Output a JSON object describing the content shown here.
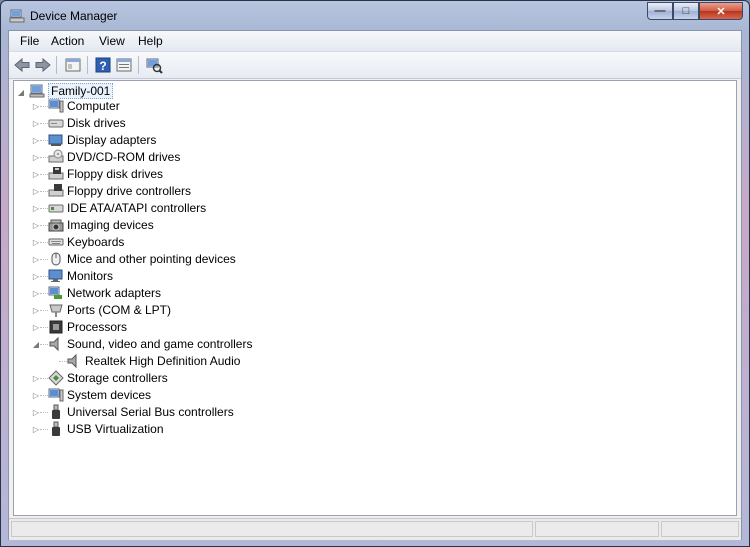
{
  "window": {
    "title": "Device Manager",
    "controls": {
      "minimize": "—",
      "maximize": "□",
      "close": "✕"
    }
  },
  "menu": [
    "File",
    "Action",
    "View",
    "Help"
  ],
  "toolbar": {
    "buttons": [
      "back-icon",
      "forward-icon",
      "show-hide-tree-icon",
      "help-icon",
      "properties-icon",
      "scan-hardware-icon"
    ]
  },
  "tree": {
    "root": "Family-001",
    "items": [
      {
        "label": "Computer",
        "icon": "computer-icon"
      },
      {
        "label": "Disk drives",
        "icon": "disk-drive-icon"
      },
      {
        "label": "Display adapters",
        "icon": "display-adapter-icon"
      },
      {
        "label": "DVD/CD-ROM drives",
        "icon": "dvd-drive-icon"
      },
      {
        "label": "Floppy disk drives",
        "icon": "floppy-disk-icon"
      },
      {
        "label": "Floppy drive controllers",
        "icon": "floppy-controller-icon"
      },
      {
        "label": "IDE ATA/ATAPI controllers",
        "icon": "ide-controller-icon"
      },
      {
        "label": "Imaging devices",
        "icon": "imaging-device-icon"
      },
      {
        "label": "Keyboards",
        "icon": "keyboard-icon"
      },
      {
        "label": "Mice and other pointing devices",
        "icon": "mouse-icon"
      },
      {
        "label": "Monitors",
        "icon": "monitor-icon"
      },
      {
        "label": "Network adapters",
        "icon": "network-adapter-icon"
      },
      {
        "label": "Ports (COM & LPT)",
        "icon": "port-icon"
      },
      {
        "label": "Processors",
        "icon": "processor-icon"
      },
      {
        "label": "Sound, video and game controllers",
        "icon": "speaker-icon",
        "expanded": true
      },
      {
        "label": "Realtek High Definition Audio",
        "icon": "speaker-icon",
        "child": true
      },
      {
        "label": "Storage controllers",
        "icon": "storage-controller-icon"
      },
      {
        "label": "System devices",
        "icon": "system-device-icon"
      },
      {
        "label": "Universal Serial Bus controllers",
        "icon": "usb-icon"
      },
      {
        "label": "USB Virtualization",
        "icon": "usb-icon"
      }
    ]
  },
  "colors": {
    "accent": "#3a6fbf",
    "selection_bg": "#eaf2fc"
  }
}
